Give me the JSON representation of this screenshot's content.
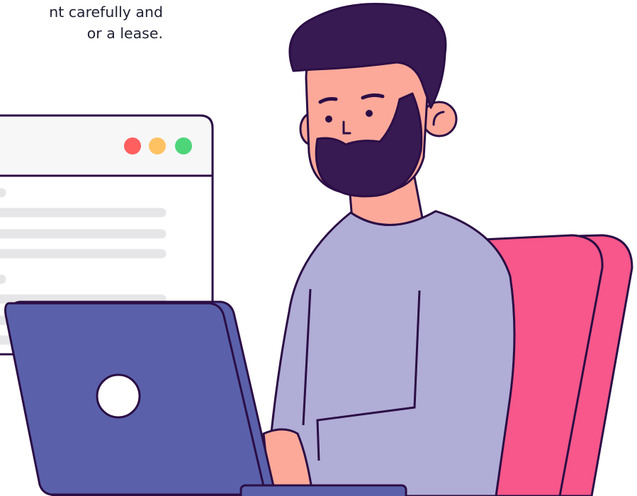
{
  "caption": {
    "line1": "nt carefully and",
    "line2": "or a lease."
  },
  "browser_window": {
    "buttons": [
      "close",
      "minimize",
      "maximize"
    ],
    "colors": {
      "close": "#ff5f5f",
      "minimize": "#ffc263",
      "maximize": "#4ed57a"
    }
  },
  "colors": {
    "outline": "#2b0e45",
    "hair": "#371a52",
    "skin": "#fca99a",
    "sweater": "#b0add6",
    "chair": "#f7578a",
    "laptop": "#5a61aa",
    "placeholder_lines": "#e6e6e8"
  },
  "icons": [
    "browser-window-illustration",
    "laptop-illustration",
    "person-illustration",
    "chair-illustration"
  ]
}
